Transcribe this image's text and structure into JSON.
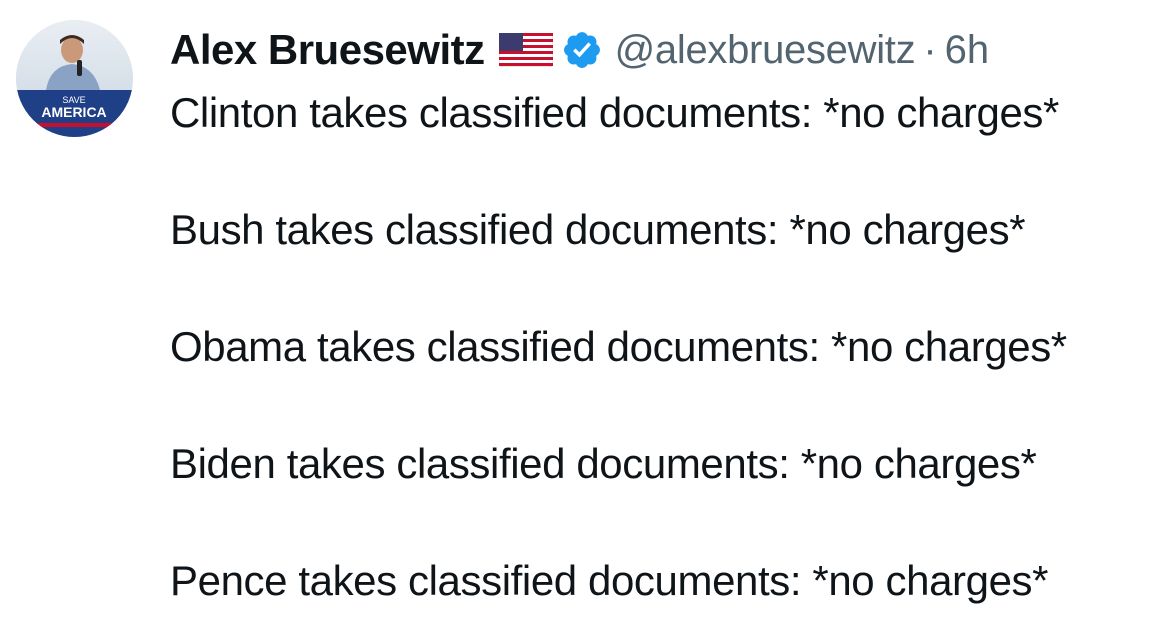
{
  "tweet": {
    "author": {
      "display_name": "Alex Bruesewitz",
      "handle": "@alexbruesewitz",
      "avatar_text_top": "SAVE",
      "avatar_text_main": "AMERICA"
    },
    "separator": "·",
    "timestamp": "6h",
    "lines": [
      "Clinton takes classified documents: *no charges*",
      "Bush takes classified documents: *no charges*",
      "Obama takes classified documents: *no charges*",
      "Biden takes classified documents: *no charges*",
      "Pence takes classified documents: *no charges*"
    ],
    "icons": {
      "flag": "us-flag-icon",
      "verified": "verified-badge-icon"
    },
    "colors": {
      "text": "#0f1419",
      "secondary": "#536471",
      "verified": "#1d9bf0"
    }
  }
}
